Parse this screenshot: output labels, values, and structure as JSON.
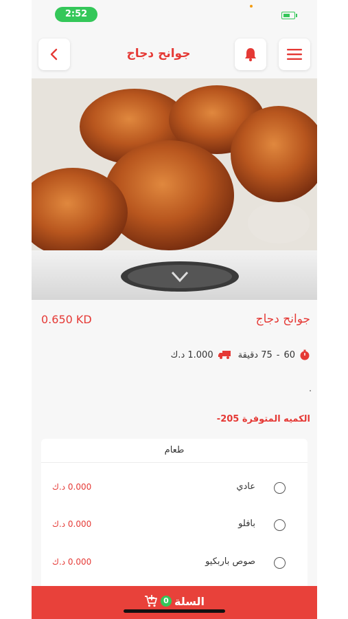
{
  "status_bar": {
    "time": "2:52"
  },
  "header": {
    "title": "جوانح دجاج"
  },
  "product": {
    "name": "جوانح دجاج",
    "price": "0.650 KD",
    "prep_time_from": "60",
    "prep_time_dash": "-",
    "prep_time_to": "75 دقيقة",
    "delivery_fee": "1.000 د.ك",
    "description": ".",
    "quantity_label": "الكميه المتوفرة",
    "quantity_value": "205-"
  },
  "options": {
    "title": "طعام",
    "items": [
      {
        "label": "عادي",
        "price": "0.000 د.ك"
      },
      {
        "label": "بافلو",
        "price": "0.000 د.ك"
      },
      {
        "label": "صوص باربكيو",
        "price": "0.000 د.ك"
      }
    ]
  },
  "cart": {
    "label": "السلة",
    "count": "0"
  },
  "colors": {
    "accent": "#e53935",
    "cart_bar": "#e8413a",
    "status_green": "#34c759"
  }
}
